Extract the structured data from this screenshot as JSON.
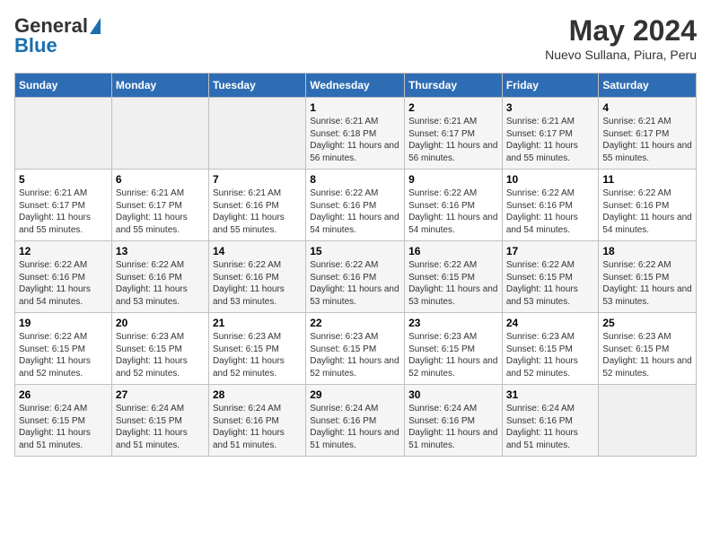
{
  "logo": {
    "general": "General",
    "blue": "Blue"
  },
  "title": "May 2024",
  "subtitle": "Nuevo  Sullana, Piura, Peru",
  "days_header": [
    "Sunday",
    "Monday",
    "Tuesday",
    "Wednesday",
    "Thursday",
    "Friday",
    "Saturday"
  ],
  "weeks": [
    [
      {
        "day": "",
        "info": ""
      },
      {
        "day": "",
        "info": ""
      },
      {
        "day": "",
        "info": ""
      },
      {
        "day": "1",
        "info": "Sunrise: 6:21 AM\nSunset: 6:18 PM\nDaylight: 11 hours and 56 minutes."
      },
      {
        "day": "2",
        "info": "Sunrise: 6:21 AM\nSunset: 6:17 PM\nDaylight: 11 hours and 56 minutes."
      },
      {
        "day": "3",
        "info": "Sunrise: 6:21 AM\nSunset: 6:17 PM\nDaylight: 11 hours and 55 minutes."
      },
      {
        "day": "4",
        "info": "Sunrise: 6:21 AM\nSunset: 6:17 PM\nDaylight: 11 hours and 55 minutes."
      }
    ],
    [
      {
        "day": "5",
        "info": "Sunrise: 6:21 AM\nSunset: 6:17 PM\nDaylight: 11 hours and 55 minutes."
      },
      {
        "day": "6",
        "info": "Sunrise: 6:21 AM\nSunset: 6:17 PM\nDaylight: 11 hours and 55 minutes."
      },
      {
        "day": "7",
        "info": "Sunrise: 6:21 AM\nSunset: 6:16 PM\nDaylight: 11 hours and 55 minutes."
      },
      {
        "day": "8",
        "info": "Sunrise: 6:22 AM\nSunset: 6:16 PM\nDaylight: 11 hours and 54 minutes."
      },
      {
        "day": "9",
        "info": "Sunrise: 6:22 AM\nSunset: 6:16 PM\nDaylight: 11 hours and 54 minutes."
      },
      {
        "day": "10",
        "info": "Sunrise: 6:22 AM\nSunset: 6:16 PM\nDaylight: 11 hours and 54 minutes."
      },
      {
        "day": "11",
        "info": "Sunrise: 6:22 AM\nSunset: 6:16 PM\nDaylight: 11 hours and 54 minutes."
      }
    ],
    [
      {
        "day": "12",
        "info": "Sunrise: 6:22 AM\nSunset: 6:16 PM\nDaylight: 11 hours and 54 minutes."
      },
      {
        "day": "13",
        "info": "Sunrise: 6:22 AM\nSunset: 6:16 PM\nDaylight: 11 hours and 53 minutes."
      },
      {
        "day": "14",
        "info": "Sunrise: 6:22 AM\nSunset: 6:16 PM\nDaylight: 11 hours and 53 minutes."
      },
      {
        "day": "15",
        "info": "Sunrise: 6:22 AM\nSunset: 6:16 PM\nDaylight: 11 hours and 53 minutes."
      },
      {
        "day": "16",
        "info": "Sunrise: 6:22 AM\nSunset: 6:15 PM\nDaylight: 11 hours and 53 minutes."
      },
      {
        "day": "17",
        "info": "Sunrise: 6:22 AM\nSunset: 6:15 PM\nDaylight: 11 hours and 53 minutes."
      },
      {
        "day": "18",
        "info": "Sunrise: 6:22 AM\nSunset: 6:15 PM\nDaylight: 11 hours and 53 minutes."
      }
    ],
    [
      {
        "day": "19",
        "info": "Sunrise: 6:22 AM\nSunset: 6:15 PM\nDaylight: 11 hours and 52 minutes."
      },
      {
        "day": "20",
        "info": "Sunrise: 6:23 AM\nSunset: 6:15 PM\nDaylight: 11 hours and 52 minutes."
      },
      {
        "day": "21",
        "info": "Sunrise: 6:23 AM\nSunset: 6:15 PM\nDaylight: 11 hours and 52 minutes."
      },
      {
        "day": "22",
        "info": "Sunrise: 6:23 AM\nSunset: 6:15 PM\nDaylight: 11 hours and 52 minutes."
      },
      {
        "day": "23",
        "info": "Sunrise: 6:23 AM\nSunset: 6:15 PM\nDaylight: 11 hours and 52 minutes."
      },
      {
        "day": "24",
        "info": "Sunrise: 6:23 AM\nSunset: 6:15 PM\nDaylight: 11 hours and 52 minutes."
      },
      {
        "day": "25",
        "info": "Sunrise: 6:23 AM\nSunset: 6:15 PM\nDaylight: 11 hours and 52 minutes."
      }
    ],
    [
      {
        "day": "26",
        "info": "Sunrise: 6:24 AM\nSunset: 6:15 PM\nDaylight: 11 hours and 51 minutes."
      },
      {
        "day": "27",
        "info": "Sunrise: 6:24 AM\nSunset: 6:15 PM\nDaylight: 11 hours and 51 minutes."
      },
      {
        "day": "28",
        "info": "Sunrise: 6:24 AM\nSunset: 6:16 PM\nDaylight: 11 hours and 51 minutes."
      },
      {
        "day": "29",
        "info": "Sunrise: 6:24 AM\nSunset: 6:16 PM\nDaylight: 11 hours and 51 minutes."
      },
      {
        "day": "30",
        "info": "Sunrise: 6:24 AM\nSunset: 6:16 PM\nDaylight: 11 hours and 51 minutes."
      },
      {
        "day": "31",
        "info": "Sunrise: 6:24 AM\nSunset: 6:16 PM\nDaylight: 11 hours and 51 minutes."
      },
      {
        "day": "",
        "info": ""
      }
    ]
  ]
}
